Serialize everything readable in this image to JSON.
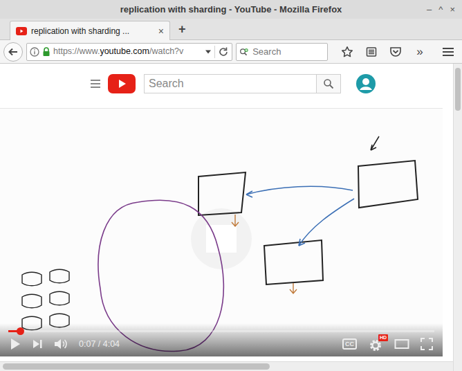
{
  "window": {
    "title": "replication with sharding - YouTube - Mozilla Firefox",
    "controls": [
      "–",
      "^",
      "×"
    ]
  },
  "tabs": [
    {
      "label": "replication with sharding ...",
      "close": "×",
      "selected": true
    }
  ],
  "new_tab": "+",
  "address": {
    "scheme": "https://www.",
    "domain": "youtube.com",
    "path": "/watch?v"
  },
  "browser_search": {
    "placeholder": "Search"
  },
  "toolbar": {
    "overflow": "»"
  },
  "youtube": {
    "search": {
      "placeholder": "Search"
    }
  },
  "player": {
    "time": "0:07 / 4:04",
    "progress": {
      "level": 0.029
    },
    "cc": "CC",
    "quality": "HD"
  }
}
